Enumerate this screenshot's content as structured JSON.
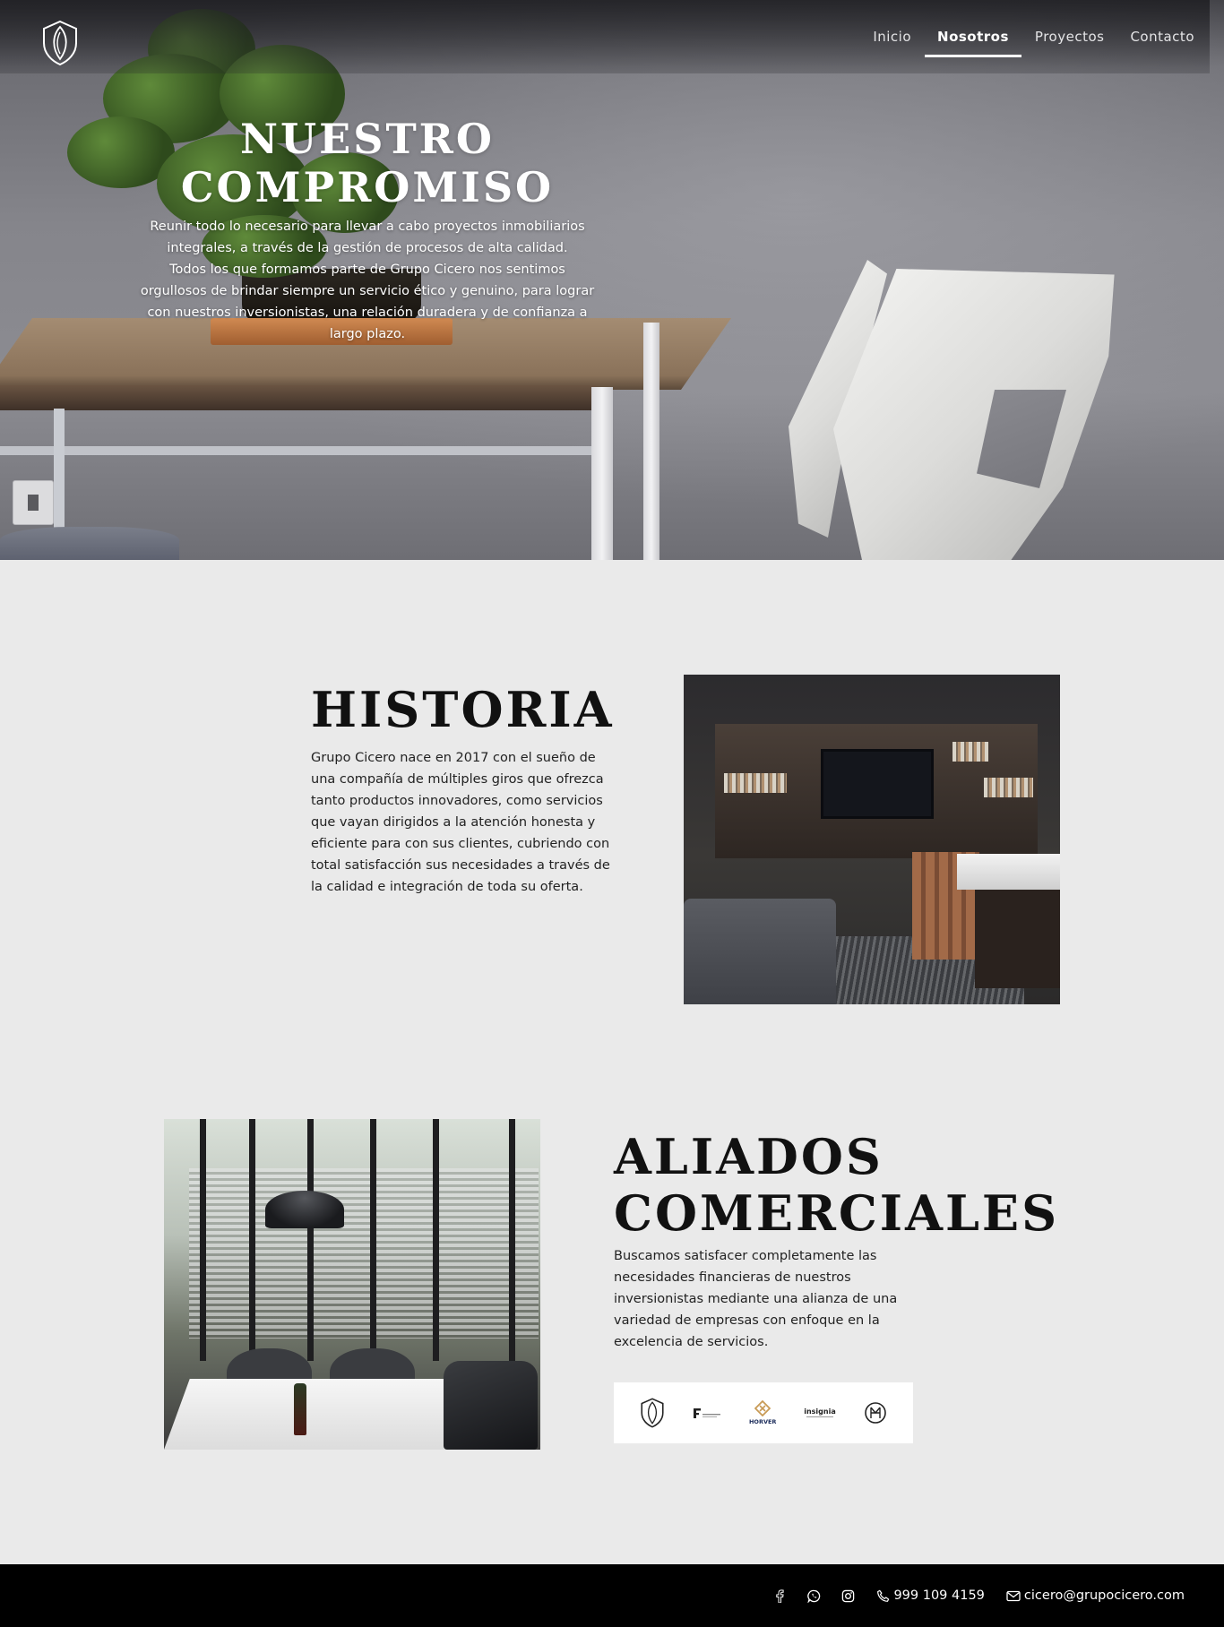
{
  "colors": {
    "page_background": "#eaeaea",
    "footer_background": "#000000",
    "text": "#111111",
    "nav_text": "#ffffff"
  },
  "nav": {
    "logo_icon": "shield-leaf-logo-icon",
    "items": [
      {
        "label": "Inicio",
        "active": false
      },
      {
        "label": "Nosotros",
        "active": true
      },
      {
        "label": "Proyectos",
        "active": false
      },
      {
        "label": "Contacto",
        "active": false
      }
    ]
  },
  "hero": {
    "title_line1": "NUESTRO",
    "title_line2": "COMPROMISO",
    "text_lines": [
      "Reunir todo lo necesario para llevar a cabo proyectos inmobiliarios",
      "integrales, a través de la gestión de procesos de alta calidad.",
      "Todos los que formamos parte de Grupo Cicero nos sentimos",
      "orgullosos de brindar siempre un servicio ético y genuino, para lograr",
      "con nuestros inversionistas, una relación duradera y de confianza a",
      "largo plazo."
    ]
  },
  "historia": {
    "title": "HISTORIA",
    "text_lines": [
      "Grupo Cicero nace en 2017 con el sueño de",
      "una compañía de múltiples giros que ofrezca",
      "tanto productos innovadores, como servicios",
      "que vayan dirigidos a la atención honesta y",
      "eficiente para con sus clientes, cubriendo con",
      "total satisfacción sus necesidades a través de",
      "la calidad e integración de toda su oferta."
    ]
  },
  "aliados": {
    "title_line1": "ALIADOS",
    "title_line2": "COMERCIALES",
    "text_lines": [
      "Buscamos satisfacer completamente las",
      "necesidades financieras de nuestros",
      "inversionistas mediante una alianza de una",
      "variedad de empresas con enfoque en la",
      "excelencia de servicios."
    ],
    "partners": [
      {
        "icon": "grupo-cicero-shield-logo-icon",
        "label": ""
      },
      {
        "icon": "fk-logo-icon",
        "label": ""
      },
      {
        "icon": "horver-logo-icon",
        "label": "HORVER"
      },
      {
        "icon": "insignia-logo-icon",
        "label": "insignia"
      },
      {
        "icon": "hm-monogram-logo-icon",
        "label": ""
      }
    ]
  },
  "footer": {
    "social_icons": [
      "facebook-icon",
      "whatsapp-icon",
      "instagram-icon"
    ],
    "phone_icon": "phone-icon",
    "phone": "999 109 4159",
    "email_icon": "envelope-icon",
    "email": "cicero@grupocicero.com"
  }
}
